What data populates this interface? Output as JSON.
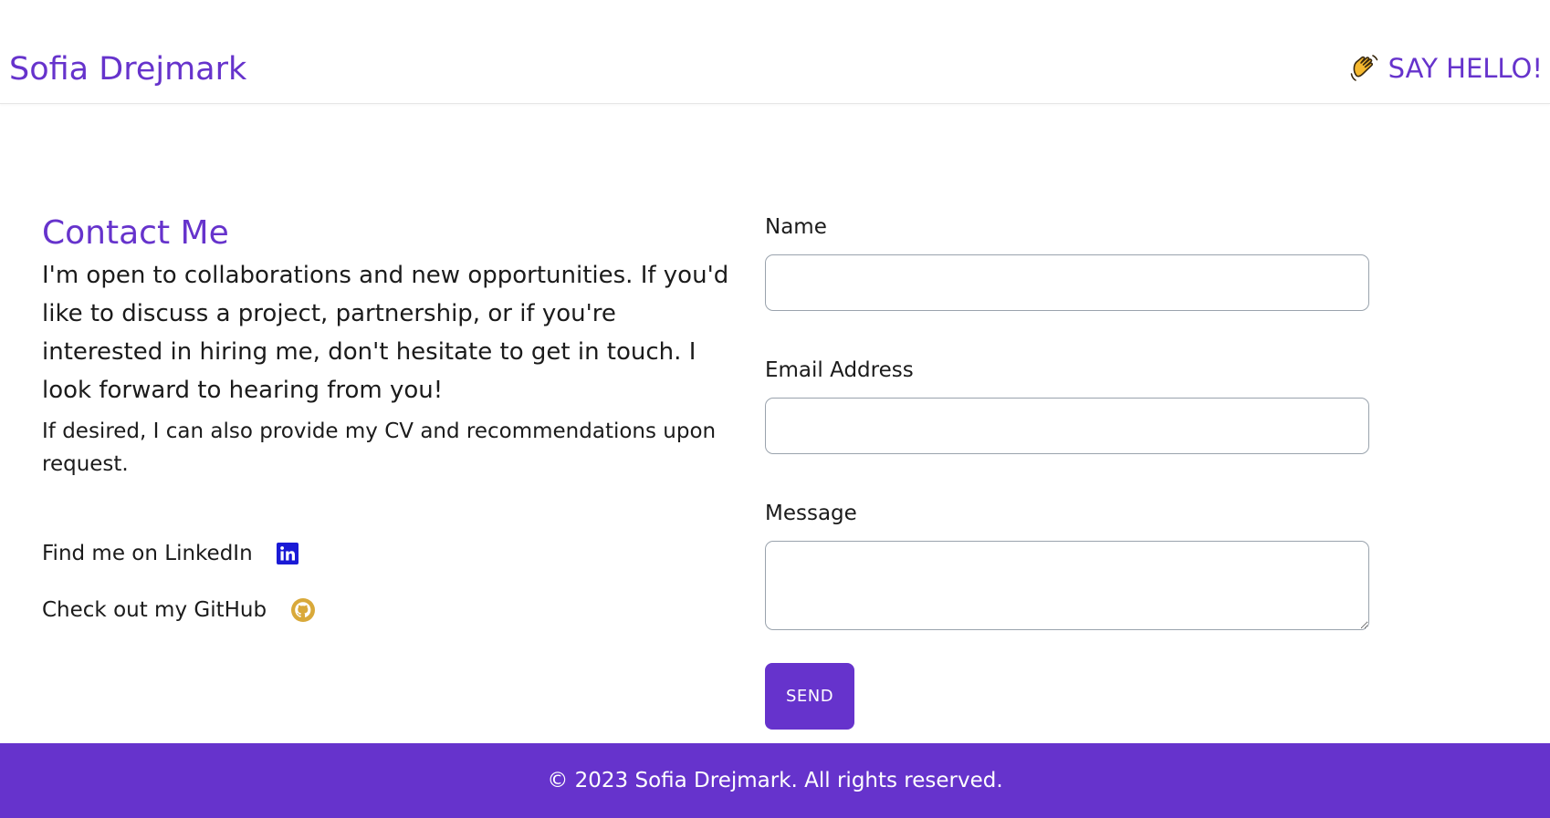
{
  "header": {
    "brand": "Sofia Drejmark",
    "say_hello_label": "SAY HELLO!",
    "say_hello_icon": "waving-hand-icon"
  },
  "contact": {
    "title": "Contact Me",
    "intro": "I'm open to collaborations and new opportunities. If you'd like to discuss a project, partnership, or if you're interested in hiring me, don't hesitate to get in touch. I look forward to hearing from you!",
    "cv_note": "If desired, I can also provide my CV and recommendations upon request.",
    "linkedin_label": "Find me on LinkedIn",
    "linkedin_icon": "linkedin-icon",
    "github_label": "Check out my GitHub",
    "github_icon": "github-icon"
  },
  "form": {
    "name_label": "Name",
    "name_value": "",
    "email_label": "Email Address",
    "email_value": "",
    "message_label": "Message",
    "message_value": "",
    "send_label": "SEND"
  },
  "footer": {
    "copyright": "© 2023 Sofia Drejmark. All rights reserved."
  },
  "colors": {
    "accent": "#6633cc",
    "linkedin": "#1a1ad6",
    "github": "#d9a93a",
    "text": "#1b1b1b",
    "input_border": "#9aa3ad"
  }
}
